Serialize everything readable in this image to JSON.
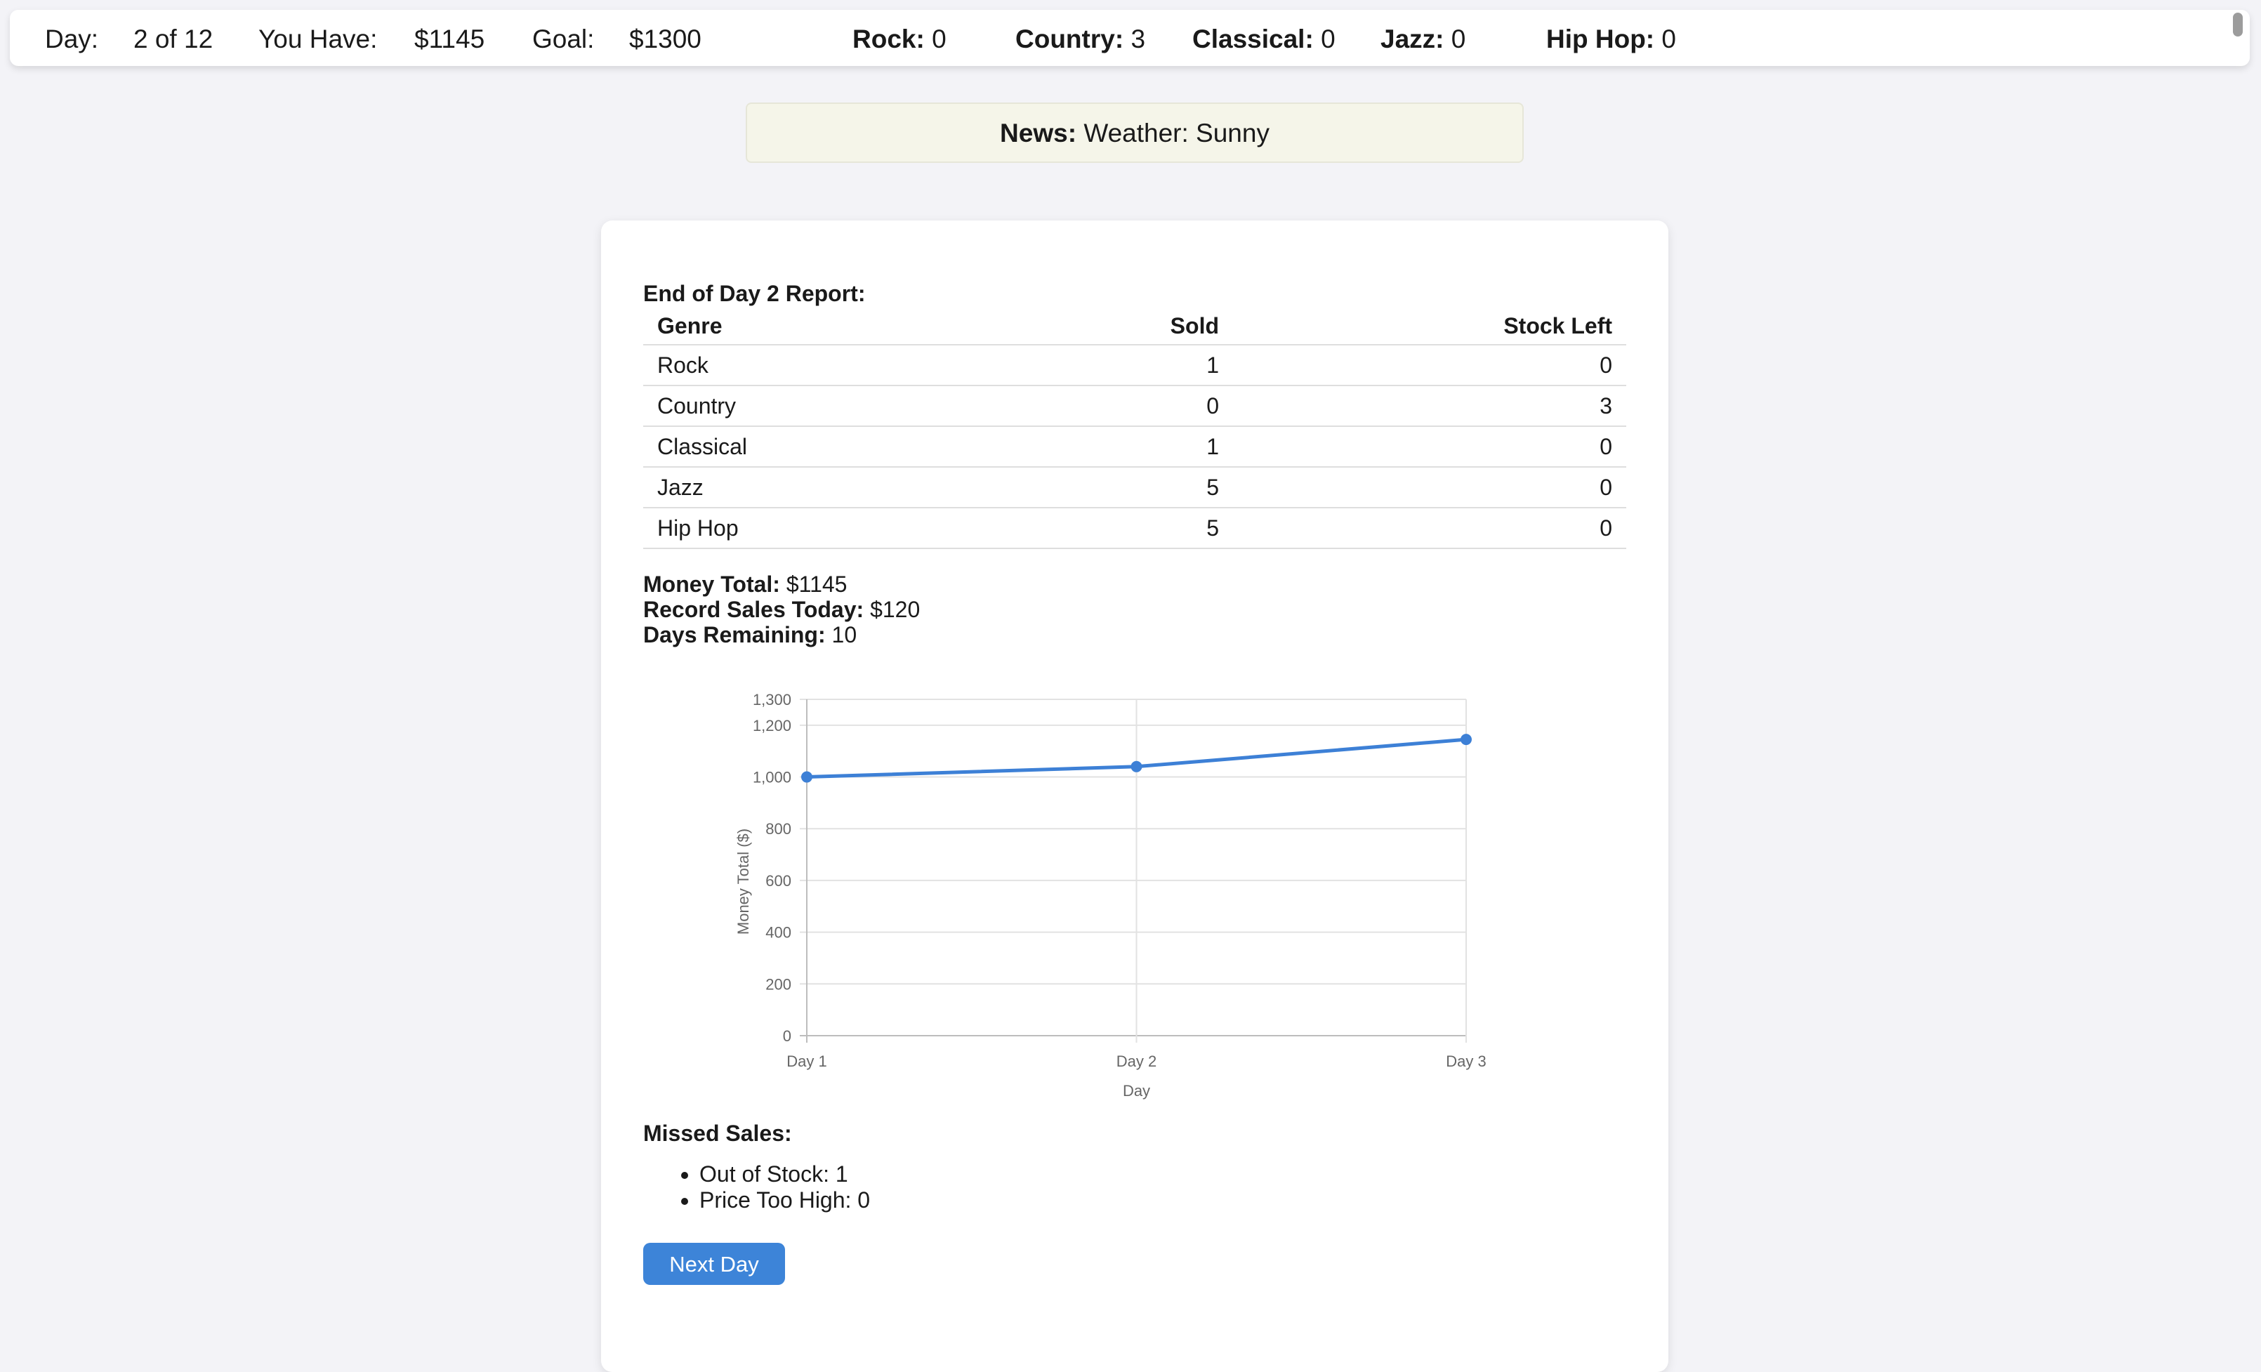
{
  "topbar": {
    "day_label": "Day:",
    "day_value": "2 of 12",
    "have_label": "You Have:",
    "have_value": "$1145",
    "goal_label": "Goal:",
    "goal_value": "$1300",
    "inventory": [
      {
        "label": "Rock:",
        "value": "0"
      },
      {
        "label": "Country:",
        "value": "3"
      },
      {
        "label": "Classical:",
        "value": "0"
      },
      {
        "label": "Jazz:",
        "value": "0"
      },
      {
        "label": "Hip Hop:",
        "value": "0"
      }
    ]
  },
  "news": {
    "label": "News:",
    "text": "Weather: Sunny"
  },
  "report": {
    "title": "End of Day 2 Report:",
    "columns": [
      "Genre",
      "Sold",
      "Stock Left"
    ],
    "rows": [
      [
        "Rock",
        "1",
        "0"
      ],
      [
        "Country",
        "0",
        "3"
      ],
      [
        "Classical",
        "1",
        "0"
      ],
      [
        "Jazz",
        "5",
        "0"
      ],
      [
        "Hip Hop",
        "5",
        "0"
      ]
    ]
  },
  "summary": {
    "money_label": "Money Total:",
    "money_value": "$1145",
    "sales_label": "Record Sales Today:",
    "sales_value": "$120",
    "days_label": "Days Remaining:",
    "days_value": "10"
  },
  "chart_data": {
    "type": "line",
    "categories": [
      "Day 1",
      "Day 2",
      "Day 3"
    ],
    "series": [
      {
        "values": [
          1000,
          1040,
          1145
        ],
        "color": "#3d80d6"
      }
    ],
    "xlabel": "Day",
    "ylabel": "Money Total ($)",
    "ylim": [
      0,
      1300
    ],
    "yticks": [
      0,
      200,
      400,
      600,
      800,
      1000,
      1200,
      1300
    ],
    "ytick_labels": [
      "0",
      "200",
      "400",
      "600",
      "800",
      "1,000",
      "1,200",
      "1,300"
    ],
    "grid": true
  },
  "missed": {
    "title": "Missed Sales:",
    "items": [
      "Out of Stock: 1",
      "Price Too High: 0"
    ]
  },
  "next_button": "Next Day"
}
